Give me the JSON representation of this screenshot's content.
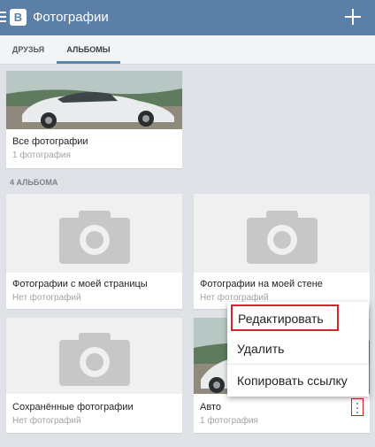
{
  "app": {
    "title": "Фотографии"
  },
  "tabs": [
    {
      "label": "ДРУЗЬЯ"
    },
    {
      "label": "АЛЬБОМЫ"
    }
  ],
  "all_photos": {
    "title": "Все фотографии",
    "count": "1 фотография"
  },
  "albums_section": {
    "heading": "4 АЛЬБОМА"
  },
  "albums": [
    {
      "title": "Фотографии с моей страницы",
      "count": "Нет фотографий"
    },
    {
      "title": "Фотографии на моей стене",
      "count": "Нет фотографий"
    },
    {
      "title": "Сохранённые фотографии",
      "count": "Нет фотографий"
    },
    {
      "title": "Авто",
      "count": "1 фотография"
    }
  ],
  "context_menu": {
    "items": [
      {
        "label": "Редактировать"
      },
      {
        "label": "Удалить"
      },
      {
        "label": "Копировать ссылку"
      }
    ]
  },
  "colors": {
    "toolbar": "#5b7fa6",
    "tab_indicator": "#5b86ad",
    "highlight": "#d1262e"
  }
}
